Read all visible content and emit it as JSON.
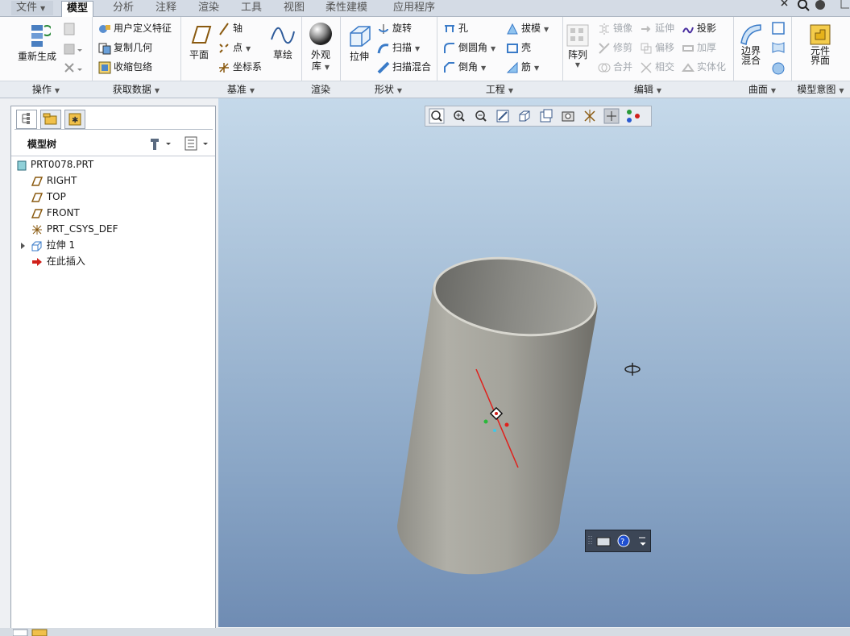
{
  "menu": {
    "file": "文件",
    "tabs": [
      "模型",
      "分析",
      "注释",
      "渲染",
      "工具",
      "视图",
      "柔性建模",
      "应用程序"
    ]
  },
  "ribbon": {
    "ops": {
      "regenerate": "重新生成",
      "label": "操作"
    },
    "getdata": {
      "user_feature": "用户定义特征",
      "copy_geom": "复制几何",
      "shrinkwrap": "收缩包络",
      "label": "获取数据"
    },
    "datum": {
      "plane": "平面",
      "axis": "轴",
      "point": "点",
      "csys": "坐标系",
      "sketch": "草绘",
      "label": "基准"
    },
    "render": {
      "appearance_line1": "外观",
      "appearance_line2": "库",
      "label": "渲染"
    },
    "shapes": {
      "extrude": "拉伸",
      "revolve": "旋转",
      "sweep": "扫描",
      "swept_blend": "扫描混合",
      "label": "形状"
    },
    "engineering": {
      "hole": "孔",
      "round": "倒圆角",
      "chamfer": "倒角",
      "draft": "拔模",
      "shell": "壳",
      "rib": "筋",
      "label": "工程"
    },
    "editing": {
      "pattern": "阵列",
      "mirror": "镜像",
      "trim": "修剪",
      "merge": "合并",
      "extend": "延伸",
      "offset": "偏移",
      "intersect": "相交",
      "project": "投影",
      "thicken": "加厚",
      "solidify": "实体化",
      "label": "编辑"
    },
    "surfaces": {
      "boundary_line1": "边界",
      "boundary_line2": "混合",
      "label": "曲面"
    },
    "intent": {
      "component_line1": "元件",
      "component_line2": "界面",
      "label": "模型意图"
    }
  },
  "tree": {
    "title": "模型树",
    "items": [
      {
        "label": "PRT0078.PRT",
        "icon": "part-icon"
      },
      {
        "label": "RIGHT",
        "icon": "datum-plane-icon"
      },
      {
        "label": "TOP",
        "icon": "datum-plane-icon"
      },
      {
        "label": "FRONT",
        "icon": "datum-plane-icon"
      },
      {
        "label": "PRT_CSYS_DEF",
        "icon": "csys-icon"
      },
      {
        "label": "拉伸 1",
        "icon": "extrude-icon"
      },
      {
        "label": "在此插入",
        "icon": "insert-arrow-icon"
      }
    ]
  },
  "colors": {
    "viewport_top": "#c5d9ea",
    "viewport_bottom": "#6f8cb3",
    "model": "#a8a79f",
    "axis": "#e0201c"
  }
}
